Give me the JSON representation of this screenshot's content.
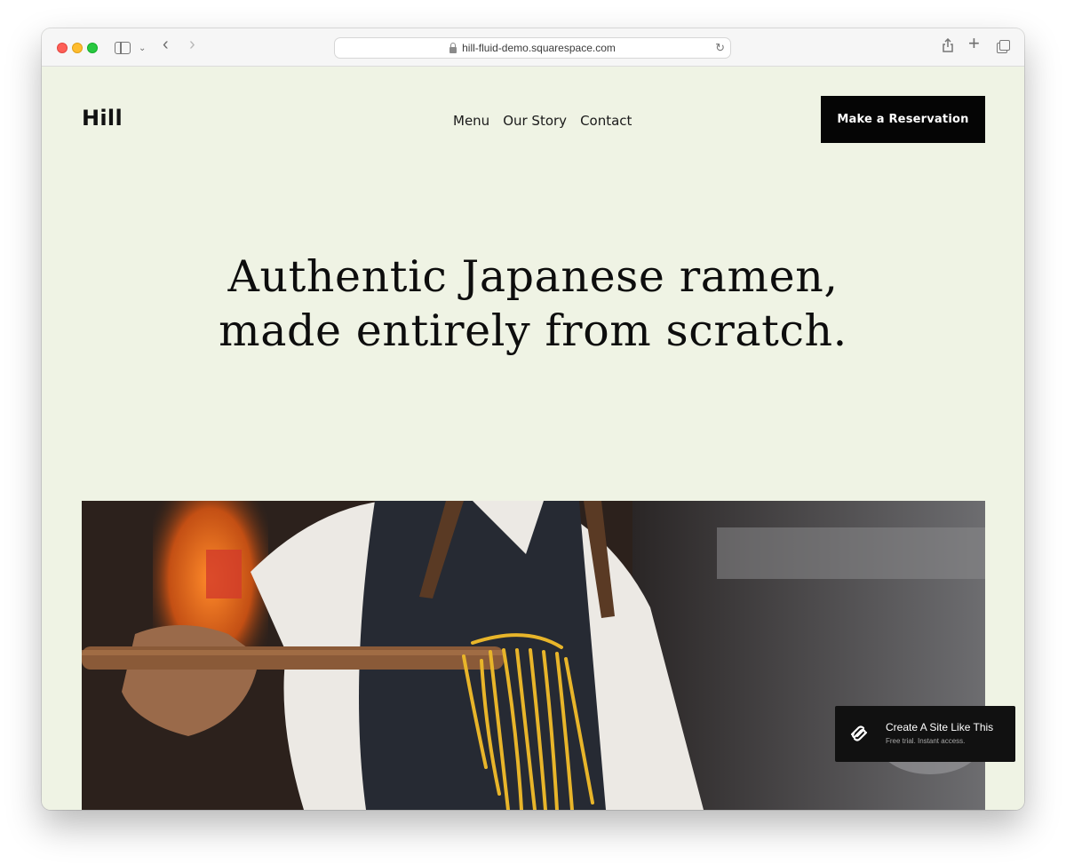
{
  "browser": {
    "url": "hill-fluid-demo.squarespace.com",
    "icons": [
      "sidebar-icon",
      "chevron-down-icon",
      "back-arrow-icon",
      "forward-arrow-icon",
      "lock-icon",
      "reload-icon",
      "share-icon",
      "plus-icon",
      "tabs-icon"
    ]
  },
  "site": {
    "logo": "Hill",
    "nav": [
      "Menu",
      "Our Story",
      "Contact"
    ],
    "cta_label": "Make a Reservation",
    "headline_line1": "Authentic Japanese ramen,",
    "headline_line2": "made entirely from scratch."
  },
  "badge": {
    "title": "Create A Site Like This",
    "subtitle": "Free trial. Instant access."
  },
  "colors": {
    "page_background": "#eff3e4",
    "cta_background": "#050505",
    "badge_background": "#111111",
    "noodles": "#e8b52a"
  }
}
